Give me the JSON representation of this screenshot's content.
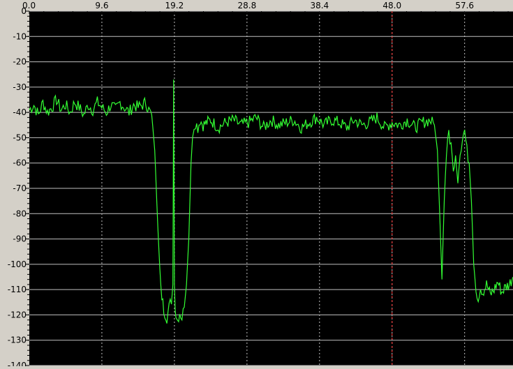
{
  "chart_data": {
    "type": "line",
    "title": "",
    "xlabel": "",
    "ylabel": "",
    "xlim": [
      0,
      64
    ],
    "ylim": [
      -140,
      0
    ],
    "x_ticks": [
      0,
      9.6,
      19.2,
      28.8,
      38.4,
      48.0,
      57.6
    ],
    "x_tick_labels": [
      "0.0",
      "9.6",
      "19.2",
      "28.8",
      "38.4",
      "48.0",
      "57.6"
    ],
    "y_ticks": [
      0,
      -10,
      -20,
      -30,
      -40,
      -50,
      -60,
      -70,
      -80,
      -90,
      -100,
      -110,
      -120,
      -130,
      -140
    ],
    "y_tick_labels": [
      "0",
      "-10",
      "-20",
      "-30",
      "-40",
      "-50",
      "-60",
      "-70",
      "-80",
      "-90",
      "-100",
      "-110",
      "-120",
      "-130",
      "-140"
    ],
    "grid": true,
    "background_color": "#000000",
    "frame_color": "#d4d0c8",
    "grid_color": "#c0c0c0",
    "marker_color": "#ff3030",
    "marker_x": 48.0,
    "series": [
      {
        "color": "#33ff33",
        "x": [
          0,
          0.6,
          1.2,
          1.8,
          2.4,
          3.0,
          3.6,
          4.2,
          4.8,
          5.4,
          6.0,
          6.6,
          7.2,
          7.8,
          8.4,
          9.0,
          9.6,
          10.2,
          10.8,
          11.4,
          12.0,
          12.6,
          13.2,
          13.8,
          14.4,
          15.0,
          15.4,
          15.8,
          16.2,
          16.6,
          17.0,
          17.4,
          17.8,
          18.2,
          18.5,
          18.8,
          19.0,
          19.1,
          19.2,
          19.3,
          19.4,
          19.6,
          19.9,
          20.2,
          20.5,
          20.8,
          21.1,
          21.4,
          21.6,
          21.8,
          22.0,
          22.3,
          22.6,
          23.0,
          23.5,
          24.0,
          25.0,
          26.0,
          27.0,
          28.0,
          29.0,
          30.0,
          31.0,
          32.0,
          33.0,
          34.0,
          35.0,
          36.0,
          37.0,
          38.0,
          39.0,
          40.0,
          41.0,
          42.0,
          43.0,
          44.0,
          45.0,
          46.0,
          47.0,
          48.0,
          49.0,
          50.0,
          51.0,
          52.0,
          53.0,
          53.6,
          54.0,
          54.3,
          54.6,
          54.9,
          55.2,
          55.5,
          55.8,
          56.1,
          56.4,
          56.7,
          57.0,
          57.3,
          57.6,
          57.9,
          58.2,
          58.5,
          58.8,
          59.1,
          59.4,
          59.7,
          60.0,
          60.5,
          61.0,
          61.5,
          62.0,
          62.5,
          63.0,
          63.5,
          64.0
        ],
        "y": [
          -39,
          -37,
          -41,
          -36,
          -40,
          -38,
          -35,
          -39,
          -37,
          -40,
          -36,
          -38,
          -41,
          -37,
          -39,
          -36,
          -38,
          -40,
          -37,
          -39,
          -36,
          -38,
          -40,
          -37,
          -38,
          -37,
          -36,
          -39,
          -41,
          -55,
          -85,
          -110,
          -118,
          -121,
          -117,
          -114,
          -108,
          -27,
          -108,
          -116,
          -120,
          -122,
          -119,
          -121,
          -117,
          -108,
          -90,
          -60,
          -48,
          -45,
          -44,
          -46,
          -43,
          -45,
          -44,
          -43,
          -46,
          -44,
          -43,
          -45,
          -44,
          -42,
          -46,
          -43,
          -45,
          -44,
          -43,
          -46,
          -44,
          -42,
          -45,
          -43,
          -44,
          -46,
          -43,
          -45,
          -44,
          -42,
          -46,
          -44,
          -45,
          -43,
          -46,
          -44,
          -43,
          -45,
          -55,
          -80,
          -106,
          -75,
          -55,
          -48,
          -52,
          -62,
          -57,
          -68,
          -56,
          -50,
          -47,
          -55,
          -60,
          -75,
          -100,
          -110,
          -113,
          -109,
          -111,
          -108,
          -112,
          -110,
          -107,
          -111,
          -109,
          -108,
          -105
        ]
      }
    ]
  }
}
